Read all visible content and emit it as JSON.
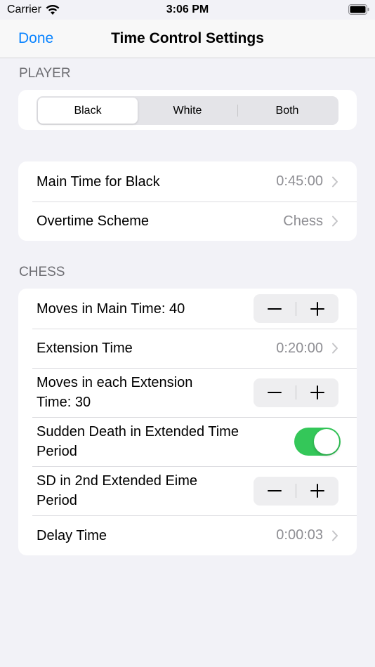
{
  "status_bar": {
    "carrier": "Carrier",
    "time": "3:06 PM"
  },
  "nav": {
    "done_label": "Done",
    "title": "Time Control Settings"
  },
  "player_section": {
    "header": "PLAYER",
    "segments": [
      "Black",
      "White",
      "Both"
    ],
    "selected": "Black"
  },
  "main_section": {
    "rows": [
      {
        "label": "Main Time for Black",
        "value": "0:45:00"
      },
      {
        "label": "Overtime Scheme",
        "value": "Chess"
      }
    ]
  },
  "chess_section": {
    "header": "CHESS",
    "moves_main": {
      "label": "Moves in Main Time: 40"
    },
    "extension_time": {
      "label": "Extension Time",
      "value": "0:20:00"
    },
    "moves_extension": {
      "label_line1": "Moves in each Extension",
      "label_line2": "Time: 30"
    },
    "sudden_death": {
      "label_line1": "Sudden Death in Extended Time",
      "label_line2": "Period",
      "on": true
    },
    "sd_second": {
      "label_line1": "SD in 2nd Extended Eime",
      "label_line2": "Period"
    },
    "delay_time": {
      "label": "Delay Time",
      "value": "0:00:03"
    }
  },
  "colors": {
    "accent": "#0a84ff",
    "toggle_on": "#34c759",
    "background": "#f2f2f7"
  },
  "icons": {
    "wifi": "wifi-icon",
    "battery": "battery-icon",
    "chevron": "chevron-right-icon",
    "minus": "minus-icon",
    "plus": "plus-icon"
  }
}
